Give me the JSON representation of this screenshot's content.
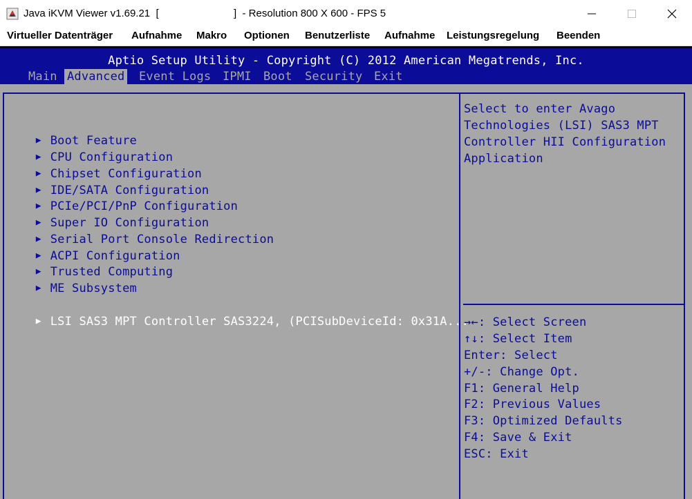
{
  "window": {
    "title": "Java iKVM Viewer v1.69.21  [                          ]  - Resolution 800 X 600 - FPS 5",
    "icons": [
      "java-app-icon",
      "minimize-icon",
      "maximize-icon",
      "close-icon"
    ]
  },
  "menubar": {
    "items": [
      "Virtueller Datenträger",
      "Aufnahme",
      "Makro",
      "Optionen",
      "Benutzerliste",
      "Aufnahme",
      "Leistungsregelung",
      "Beenden"
    ]
  },
  "bios": {
    "title": "Aptio Setup Utility - Copyright (C) 2012 American Megatrends, Inc.",
    "tabs": [
      "Main",
      "Advanced",
      "Event Logs",
      "IPMI",
      "Boot",
      "Security",
      "Exit"
    ],
    "active_tab": "Advanced",
    "menu_items": [
      "Boot Feature",
      "CPU Configuration",
      "Chipset Configuration",
      "IDE/SATA Configuration",
      "PCIe/PCI/PnP Configuration",
      "Super IO Configuration",
      "Serial Port Console Redirection",
      "ACPI Configuration",
      "Trusted Computing",
      "ME Subsystem",
      "LSI SAS3 MPT Controller SAS3224, (PCISubDeviceId: 0x31A..."
    ],
    "selected_item": "LSI SAS3 MPT Controller SAS3224, (PCISubDeviceId: 0x31A...",
    "help_text": [
      "Select to enter Avago",
      "Technologies (LSI) SAS3 MPT",
      "Controller HII Configuration",
      "Application"
    ],
    "key_help": [
      "→←: Select Screen",
      "↑↓: Select Item",
      "Enter: Select",
      "+/-: Change Opt.",
      "F1: General Help",
      "F2: Previous Values",
      "F3: Optimized Defaults",
      "F4: Save & Exit",
      "ESC: Exit"
    ],
    "colors": {
      "background": "#a7a7a7",
      "accent_blue": "#0b0c97",
      "highlight": "#ffffff"
    }
  }
}
